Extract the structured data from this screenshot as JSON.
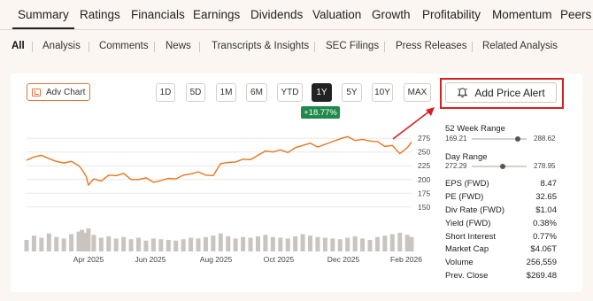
{
  "top_tabs": [
    "Summary",
    "Ratings",
    "Financials",
    "Earnings",
    "Dividends",
    "Valuation",
    "Growth",
    "Profitability",
    "Momentum",
    "Peers"
  ],
  "sub_tabs": [
    "All",
    "Analysis",
    "Comments",
    "News",
    "Transcripts & Insights",
    "SEC Filings",
    "Press Releases",
    "Related Analysis"
  ],
  "toolbar": {
    "adv_chart_label": "Adv Chart",
    "ranges": [
      "1D",
      "5D",
      "1M",
      "6M",
      "YTD",
      "1Y",
      "5Y",
      "10Y",
      "MAX"
    ],
    "active_range": "1Y",
    "change": "+18.77%",
    "alert_label": "Add Price Alert"
  },
  "colors": {
    "line": "#e8761e",
    "accent": "#e2753b",
    "up": "#1f8a4c",
    "highlight": "#d92020"
  },
  "chart_data": {
    "type": "line",
    "x_ticks": [
      "Apr 2025",
      "Jun 2025",
      "Aug 2025",
      "Oct 2025",
      "Dec 2025",
      "Feb 2026"
    ],
    "y_ticks": [
      "275",
      "250",
      "225",
      "200",
      "175",
      "150"
    ],
    "ylim": [
      140,
      285
    ],
    "grid": true,
    "series": [
      {
        "x": [
          "2025-02-10",
          "2025-02-17",
          "2025-02-24",
          "2025-03-03",
          "2025-03-10",
          "2025-03-17",
          "2025-03-24",
          "2025-03-31",
          "2025-04-03",
          "2025-04-07",
          "2025-04-09",
          "2025-04-14",
          "2025-04-21",
          "2025-04-28",
          "2025-05-05",
          "2025-05-12",
          "2025-05-19",
          "2025-05-26",
          "2025-06-02",
          "2025-06-09",
          "2025-06-16",
          "2025-06-23",
          "2025-06-30",
          "2025-07-07",
          "2025-07-14",
          "2025-07-21",
          "2025-07-28",
          "2025-08-04",
          "2025-08-11",
          "2025-08-18",
          "2025-08-25",
          "2025-09-01",
          "2025-09-08",
          "2025-09-15",
          "2025-09-22",
          "2025-09-29",
          "2025-10-06",
          "2025-10-13",
          "2025-10-20",
          "2025-10-27",
          "2025-11-03",
          "2025-11-10",
          "2025-11-17",
          "2025-11-24",
          "2025-12-01",
          "2025-12-08",
          "2025-12-15",
          "2025-12-22",
          "2025-12-29",
          "2026-01-05",
          "2026-01-12",
          "2026-01-19",
          "2026-01-26",
          "2026-02-02",
          "2026-02-06"
        ],
        "values": [
          235,
          241,
          244,
          238,
          233,
          230,
          233,
          225,
          218,
          205,
          190,
          201,
          197,
          208,
          207,
          211,
          200,
          200,
          203,
          195,
          198,
          202,
          201,
          208,
          210,
          214,
          208,
          207,
          229,
          231,
          232,
          237,
          236,
          244,
          252,
          250,
          254,
          249,
          258,
          262,
          266,
          259,
          264,
          269,
          274,
          278,
          271,
          273,
          270,
          269,
          260,
          262,
          247,
          258,
          268
        ]
      }
    ],
    "volume": [
      32,
      44,
      38,
      50,
      40,
      36,
      48,
      55,
      60,
      52,
      64,
      46,
      38,
      42,
      36,
      40,
      34,
      38,
      30,
      36,
      34,
      32,
      30,
      34,
      38,
      36,
      40,
      44,
      50,
      42,
      36,
      40,
      38,
      42,
      46,
      40,
      38,
      36,
      42,
      48,
      44,
      40,
      38,
      36,
      34,
      38,
      42,
      36,
      32,
      40,
      44,
      48,
      52,
      46,
      40
    ]
  },
  "week52": {
    "label": "52 Week Range",
    "low": "169.21",
    "high": "288.62",
    "position": 0.84
  },
  "day_range": {
    "label": "Day Range",
    "low": "272.29",
    "high": "278.95",
    "position": 0.57
  },
  "stats": [
    {
      "label": "EPS (FWD)",
      "value": "8.47"
    },
    {
      "label": "PE (FWD)",
      "value": "32.65"
    },
    {
      "label": "Div Rate (FWD)",
      "value": "$1.04"
    },
    {
      "label": "Yield (FWD)",
      "value": "0.38%"
    },
    {
      "label": "Short Interest",
      "value": "0.77%"
    },
    {
      "label": "Market Cap",
      "value": "$4.06T"
    },
    {
      "label": "Volume",
      "value": "256,559"
    },
    {
      "label": "Prev. Close",
      "value": "$269.48"
    }
  ]
}
